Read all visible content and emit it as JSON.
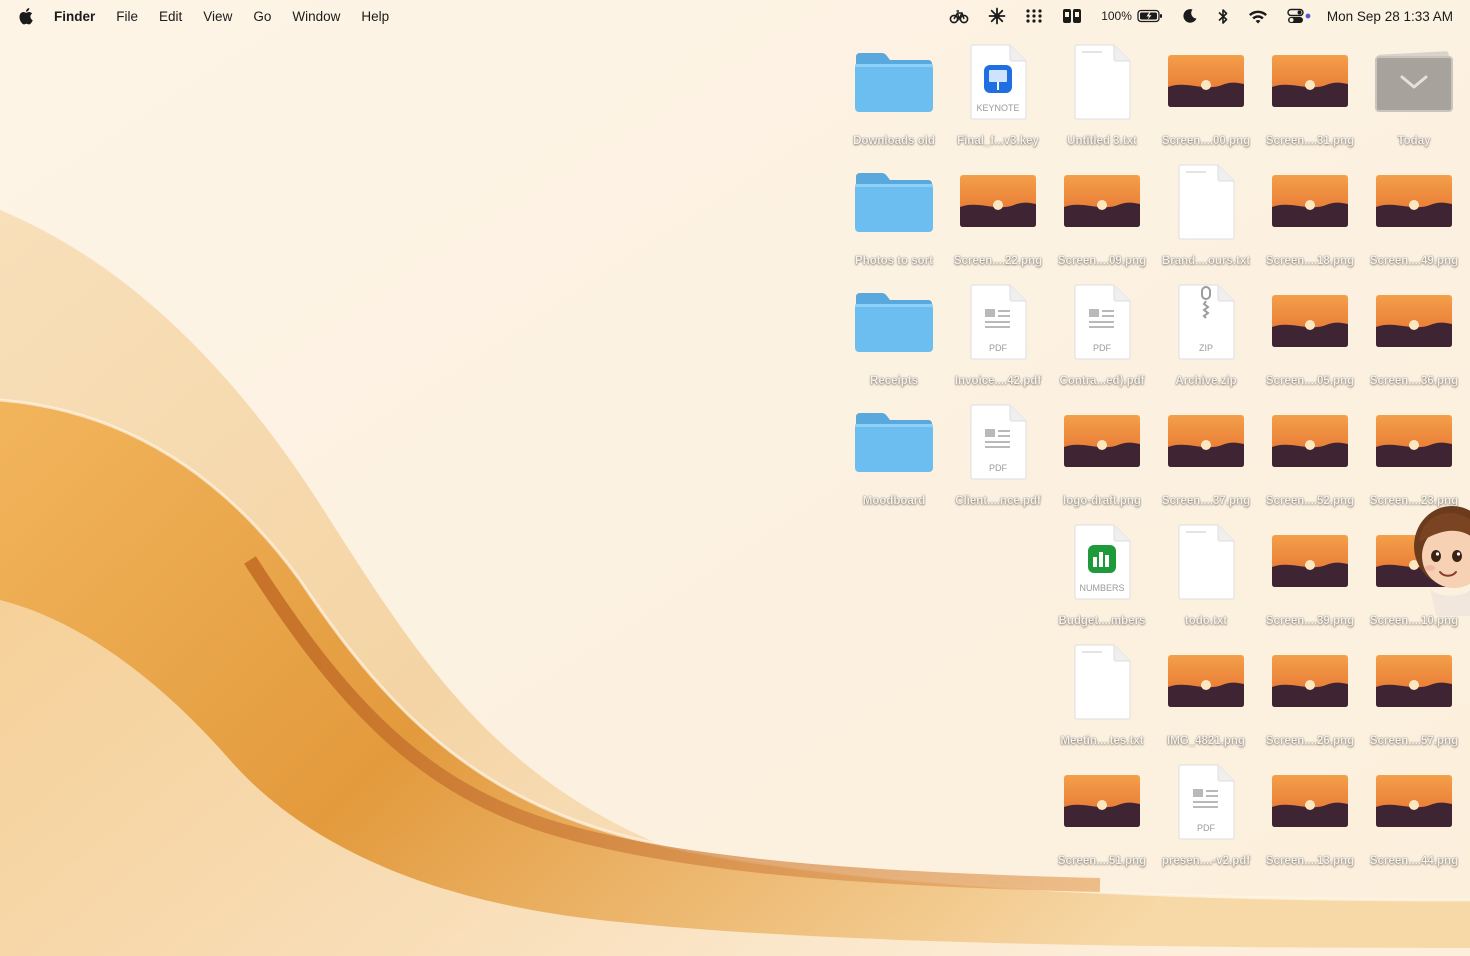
{
  "menubar": {
    "app": "Finder",
    "menus": [
      "File",
      "Edit",
      "View",
      "Go",
      "Window",
      "Help"
    ],
    "battery": "100%",
    "clock": "Mon Sep 28  1:33 AM"
  },
  "colors": {
    "folder": "#6cbdf0",
    "sunset_sky": "#ee8a3b",
    "sunset_ground": "#3f2433",
    "label_text": "#f7f2ea"
  },
  "desktop": {
    "items": [
      {
        "col": 0,
        "row": 0,
        "kind": "folder",
        "label": "Downloads old"
      },
      {
        "col": 1,
        "row": 0,
        "kind": "keynote",
        "label": "Final_f...v3.key",
        "badge": "KEYNOTE"
      },
      {
        "col": 2,
        "row": 0,
        "kind": "txt",
        "label": "Untitled 3.txt"
      },
      {
        "col": 3,
        "row": 0,
        "kind": "png",
        "label": "Screen....00.png"
      },
      {
        "col": 4,
        "row": 0,
        "kind": "png",
        "label": "Screen....31.png"
      },
      {
        "col": 5,
        "row": 0,
        "kind": "stack",
        "label": "Today"
      },
      {
        "col": 0,
        "row": 1,
        "kind": "folder",
        "label": "Photos to sort"
      },
      {
        "col": 1,
        "row": 1,
        "kind": "png",
        "label": "Screen....22.png"
      },
      {
        "col": 2,
        "row": 1,
        "kind": "png",
        "label": "Screen....09.png"
      },
      {
        "col": 3,
        "row": 1,
        "kind": "txt",
        "label": "Brand....ours.txt"
      },
      {
        "col": 4,
        "row": 1,
        "kind": "png",
        "label": "Screen....18.png"
      },
      {
        "col": 5,
        "row": 1,
        "kind": "png",
        "label": "Screen....49.png"
      },
      {
        "col": 0,
        "row": 2,
        "kind": "folder",
        "label": "Receipts"
      },
      {
        "col": 1,
        "row": 2,
        "kind": "pdf",
        "label": "Invoice....42.pdf",
        "badge": "PDF"
      },
      {
        "col": 2,
        "row": 2,
        "kind": "pdf",
        "label": "Contra...ed).pdf",
        "badge": "PDF"
      },
      {
        "col": 3,
        "row": 2,
        "kind": "zip",
        "label": "Archive.zip",
        "badge": "ZIP"
      },
      {
        "col": 4,
        "row": 2,
        "kind": "png",
        "label": "Screen....05.png"
      },
      {
        "col": 5,
        "row": 2,
        "kind": "png",
        "label": "Screen....36.png"
      },
      {
        "col": 0,
        "row": 3,
        "kind": "folder",
        "label": "Moodboard"
      },
      {
        "col": 1,
        "row": 3,
        "kind": "pdf",
        "label": "Client....nce.pdf",
        "badge": "PDF"
      },
      {
        "col": 2,
        "row": 3,
        "kind": "png",
        "label": "logo-draft.png"
      },
      {
        "col": 3,
        "row": 3,
        "kind": "png",
        "label": "Screen....37.png"
      },
      {
        "col": 4,
        "row": 3,
        "kind": "png",
        "label": "Screen....52.png"
      },
      {
        "col": 5,
        "row": 3,
        "kind": "png",
        "label": "Screen....23.png"
      },
      {
        "col": 2,
        "row": 4,
        "kind": "numbers",
        "label": "Budget....mbers",
        "badge": "NUMBERS"
      },
      {
        "col": 3,
        "row": 4,
        "kind": "txt",
        "label": "todo.txt"
      },
      {
        "col": 4,
        "row": 4,
        "kind": "png",
        "label": "Screen....39.png"
      },
      {
        "col": 5,
        "row": 4,
        "kind": "png",
        "label": "Screen....10.png"
      },
      {
        "col": 2,
        "row": 5,
        "kind": "txt",
        "label": "Meetin....tes.txt"
      },
      {
        "col": 3,
        "row": 5,
        "kind": "png",
        "label": "IMG_4821.png"
      },
      {
        "col": 4,
        "row": 5,
        "kind": "png",
        "label": "Screen....26.png"
      },
      {
        "col": 5,
        "row": 5,
        "kind": "png",
        "label": "Screen....57.png"
      },
      {
        "col": 2,
        "row": 6,
        "kind": "png",
        "label": "Screen....51.png"
      },
      {
        "col": 3,
        "row": 6,
        "kind": "pdf",
        "label": "presen....-v2.pdf",
        "badge": "PDF"
      },
      {
        "col": 4,
        "row": 6,
        "kind": "png",
        "label": "Screen....13.png"
      },
      {
        "col": 5,
        "row": 6,
        "kind": "png",
        "label": "Screen....44.png"
      }
    ]
  }
}
